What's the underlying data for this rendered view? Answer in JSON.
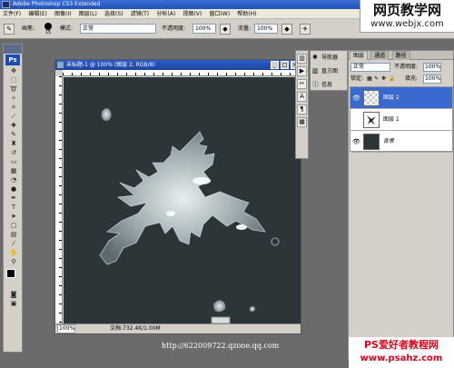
{
  "app": {
    "title": "Adobe Photoshop CS3 Extended"
  },
  "menu": [
    "文件(F)",
    "编辑(E)",
    "图像(I)",
    "图层(L)",
    "选择(S)",
    "滤镜(T)",
    "分析(A)",
    "视图(V)",
    "窗口(W)",
    "帮助(H)"
  ],
  "options": {
    "brush_label": "画笔:",
    "brush_size": "15",
    "mode_label": "模式:",
    "mode_value": "正常",
    "opacity_label": "不透明度:",
    "opacity_value": "100%",
    "flow_label": "流量:",
    "flow_value": "100%"
  },
  "tools": {
    "ps_label": "Ps"
  },
  "document": {
    "title": "未标题-1 @ 100% (图层 2, RGB/8)",
    "zoom": "100%",
    "doc_info": "文档:732.4K/1.00M"
  },
  "navigator": {
    "items": [
      {
        "label": "导航器",
        "icon": "navigator-icon"
      },
      {
        "label": "直方图",
        "icon": "histogram-icon"
      },
      {
        "label": "信息",
        "icon": "info-icon"
      }
    ]
  },
  "layers": {
    "tabs": [
      "图层",
      "通道",
      "路径"
    ],
    "blend_mode": "正常",
    "opacity_label": "不透明度:",
    "opacity_value": "100%",
    "lock_label": "锁定:",
    "fill_label": "填充:",
    "fill_value": "100%",
    "items": [
      {
        "name": "图层 2",
        "active": true
      },
      {
        "name": "图层 1",
        "active": false
      },
      {
        "name": "背景",
        "active": false
      }
    ]
  },
  "watermarks": {
    "top_cn": "网页教学网",
    "top_url": "www.webjx.com",
    "url": "http://622009722.qzone.qq.com",
    "bottom_cn": "PS爱好者教程网",
    "bottom_url": "www.psahz.com"
  }
}
